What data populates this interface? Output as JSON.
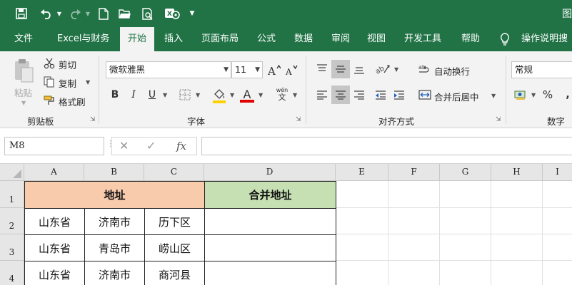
{
  "titlebar": {
    "title_partial": "图",
    "background": "#217346"
  },
  "tabs": [
    "文件",
    "Excel与财务",
    "开始",
    "插入",
    "页面布局",
    "公式",
    "数据",
    "审阅",
    "视图",
    "开发工具",
    "帮助",
    "操作说明搜"
  ],
  "active_tab": "开始",
  "ribbon": {
    "clipboard": {
      "paste": "粘贴",
      "cut": "剪切",
      "copy": "复制",
      "format_painter": "格式刷",
      "label": "剪贴板"
    },
    "font": {
      "font_name": "微软雅黑",
      "font_size": "11",
      "bold": "B",
      "italic": "I",
      "underline": "U",
      "font_color_letter": "A",
      "phonetic": "wén",
      "label": "字体",
      "fill_color": "#ffd000",
      "font_color": "#e00000"
    },
    "alignment": {
      "wrap_text": "自动换行",
      "merge_center": "合并后居中",
      "label": "对齐方式"
    },
    "number": {
      "format": "常规",
      "percent": "%",
      "label": "数字"
    }
  },
  "formula_bar": {
    "name_box": "M8",
    "fx": "fx",
    "formula": ""
  },
  "sheet": {
    "columns": [
      "A",
      "B",
      "C",
      "D",
      "E",
      "F",
      "G",
      "H",
      "I"
    ],
    "rows": [
      "1",
      "2",
      "3",
      "4"
    ],
    "header_address": "地址",
    "header_merged": "合并地址",
    "header_address_color": "#f8cbad",
    "header_merged_color": "#c6e0b4",
    "data": [
      [
        "山东省",
        "济南市",
        "历下区"
      ],
      [
        "山东省",
        "青岛市",
        "崂山区"
      ],
      [
        "山东省",
        "济南市",
        "商河县"
      ]
    ]
  }
}
